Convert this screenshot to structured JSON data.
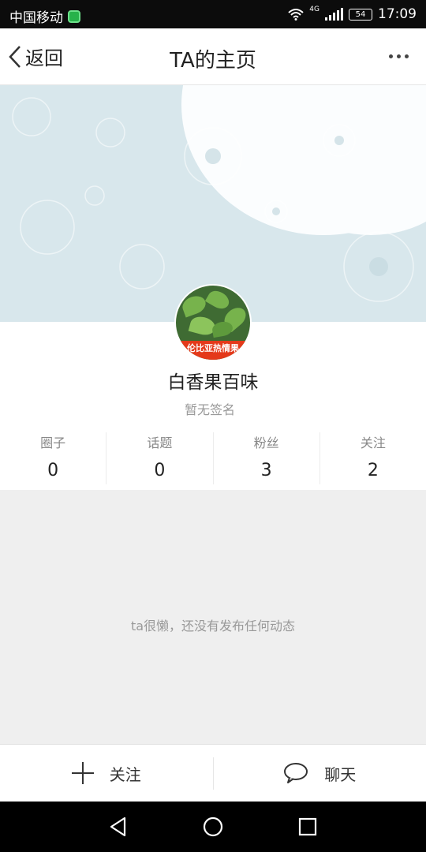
{
  "status_bar": {
    "carrier": "中国移动",
    "network": "4G",
    "battery": "54",
    "time": "17:09"
  },
  "nav": {
    "back_label": "返回",
    "title": "TA的主页"
  },
  "profile": {
    "avatar_banner": "伦比亚热情果",
    "username": "白香果百味",
    "signature": "暂无签名"
  },
  "stats": [
    {
      "label": "圈子",
      "value": "0"
    },
    {
      "label": "话题",
      "value": "0"
    },
    {
      "label": "粉丝",
      "value": "3"
    },
    {
      "label": "关注",
      "value": "2"
    }
  ],
  "feed": {
    "empty_text": "ta很懒，还没有发布任何动态"
  },
  "actions": {
    "follow_label": "关注",
    "chat_label": "聊天"
  },
  "colors": {
    "cover": "#d8e7ec",
    "accent_badge": "#27b24a",
    "avatar_banner": "#e4391a"
  }
}
